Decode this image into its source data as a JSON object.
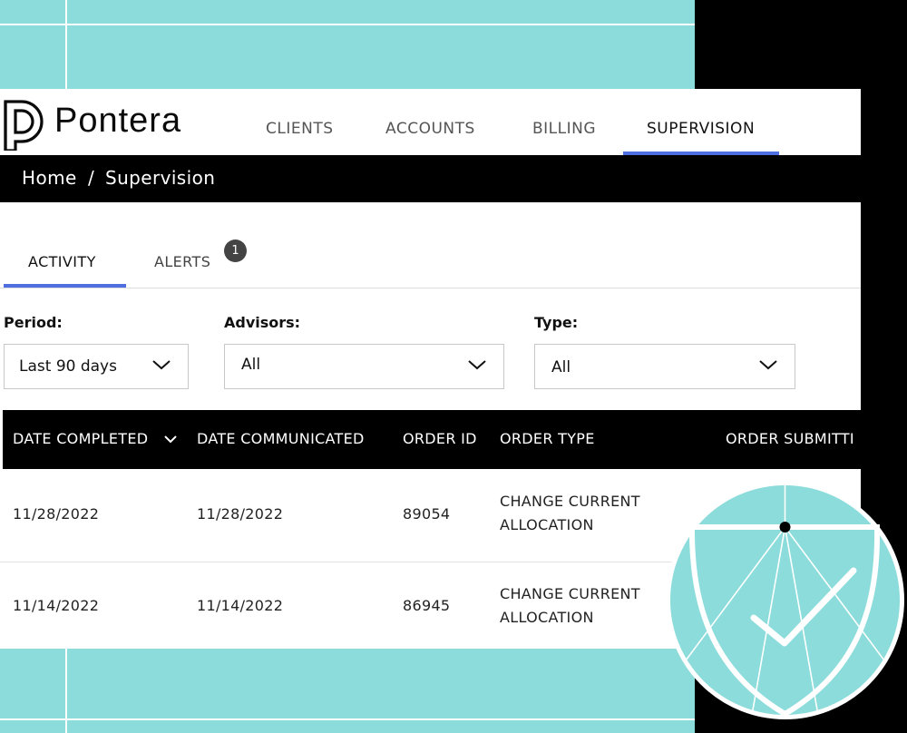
{
  "brand": {
    "name": "Pontera"
  },
  "nav": {
    "items": [
      {
        "label": "CLIENTS"
      },
      {
        "label": "ACCOUNTS"
      },
      {
        "label": "BILLING"
      },
      {
        "label": "SUPERVISION"
      }
    ],
    "active": "SUPERVISION"
  },
  "breadcrumb": {
    "home": "Home",
    "separator": "/",
    "current": "Supervision"
  },
  "tabs": {
    "activity": "ACTIVITY",
    "alerts": "ALERTS",
    "alerts_count": "1"
  },
  "filters": {
    "period": {
      "label": "Period:",
      "value": "Last 90 days"
    },
    "advisors": {
      "label": "Advisors:",
      "value": "All"
    },
    "type": {
      "label": "Type:",
      "value": "All"
    }
  },
  "table": {
    "columns": [
      "DATE COMPLETED",
      "DATE COMMUNICATED",
      "ORDER ID",
      "ORDER TYPE",
      "ORDER SUBMITTI"
    ],
    "rows": [
      {
        "date_completed": "11/28/2022",
        "date_communicated": "11/28/2022",
        "order_id": "89054",
        "order_type_1": "CHANGE CURRENT",
        "order_type_2": "ALLOCATION"
      },
      {
        "date_completed": "11/14/2022",
        "date_communicated": "11/14/2022",
        "order_id": "86945",
        "order_type_1": "CHANGE CURRENT",
        "order_type_2": "ALLOCATION"
      }
    ]
  },
  "colors": {
    "teal": "#8bdcdb",
    "accent_blue": "#4f6fe0",
    "black": "#000000"
  },
  "icons": {
    "sort": "chevron-down-icon",
    "select": "chevron-down-icon",
    "decor": "shield-check-icon"
  }
}
